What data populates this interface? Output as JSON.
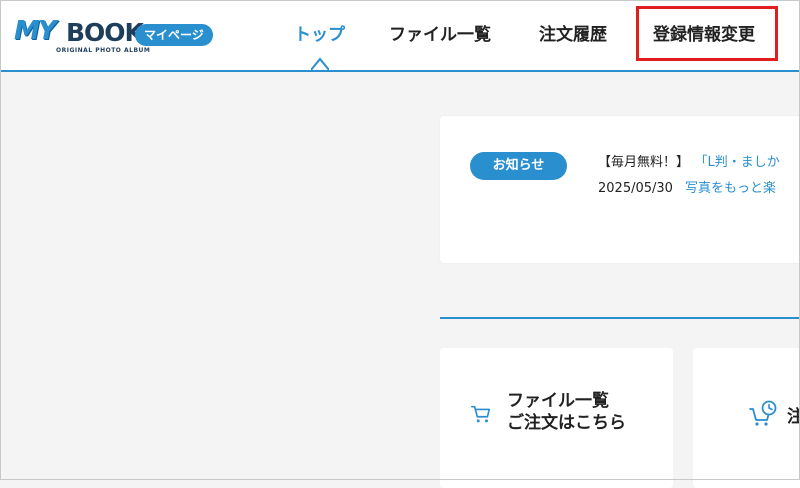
{
  "logo": {
    "brand_my": "MY",
    "brand_book": "BOOK",
    "tagline": "ORIGINAL PHOTO ALBUM",
    "badge": "マイページ"
  },
  "nav": {
    "items": [
      {
        "label": "トップ"
      },
      {
        "label": "ファイル一覧"
      },
      {
        "label": "注文履歴"
      },
      {
        "label": "登録情報変更"
      }
    ]
  },
  "notice": {
    "badge": "お知らせ",
    "tag": "【毎月無料！】",
    "title": "「L判・ましか",
    "date": "2025/05/30",
    "summary": "写真をもっと楽"
  },
  "menu": {
    "files": {
      "line1": "ファイル一覧",
      "line2": "ご注文はこちら"
    },
    "history": {
      "label": "注"
    }
  },
  "colors": {
    "accent": "#2a8fcf",
    "highlight": "#e01e1e"
  }
}
